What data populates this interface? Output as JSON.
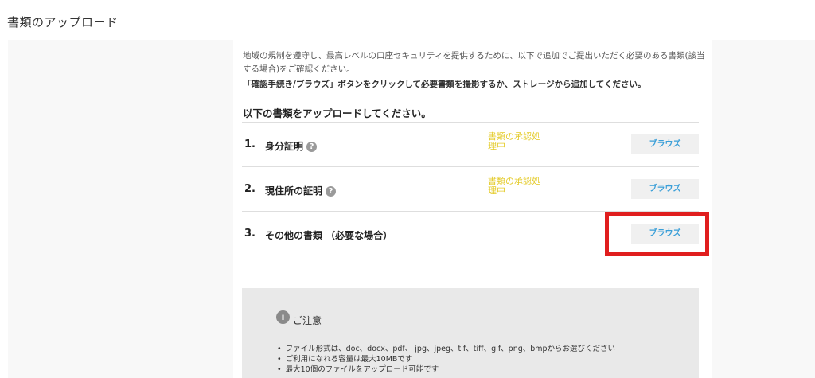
{
  "page": {
    "title": "書類のアップロード"
  },
  "intro": {
    "text": "地域の規制を遵守し、最高レベルの口座セキュリティを提供するために、以下で追加でご提出いただく必要のある書類(該当する場合)をご確認ください。",
    "instruction": "「確認手続き/ブラウズ」ボタンをクリックして必要書類を撮影するか、ストレージから追加してください。"
  },
  "section": {
    "heading": "以下の書類をアップロードしてください。"
  },
  "documents": [
    {
      "num": "1.",
      "label": "身分証明",
      "help": "?",
      "status": "書類の承認処理中",
      "button": "ブラウズ"
    },
    {
      "num": "2.",
      "label": "現住所の証明",
      "help": "?",
      "status": "書類の承認処理中",
      "button": "ブラウズ"
    },
    {
      "num": "3.",
      "label": "その他の書類 （必要な場合）",
      "button": "ブラウズ"
    }
  ],
  "notice": {
    "icon": "i",
    "title": "ご注意",
    "items": [
      "ファイル形式は、doc、docx、pdf、 jpg、jpeg、tif、tiff、gif、png、bmpからお選びください",
      "ご利用になれる容量は最大10MBです",
      "最大10個のファイルをアップロード可能です"
    ]
  },
  "colors": {
    "accent_blue": "#3a9fd8",
    "status_yellow": "#e4cb2a",
    "highlight_red": "#e01e1e"
  },
  "icons": {
    "help": "question-circle-icon",
    "notice": "info-circle-icon"
  }
}
